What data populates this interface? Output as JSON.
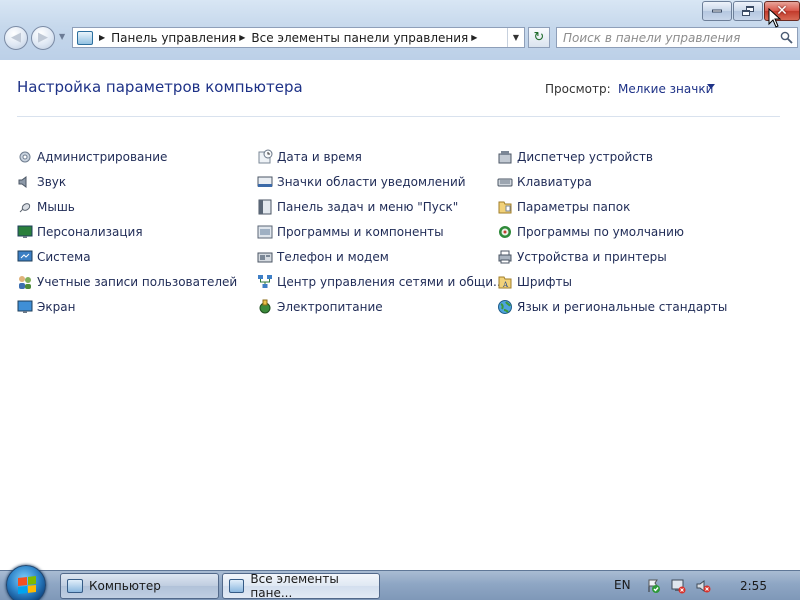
{
  "window": {
    "address": {
      "crumbs": [
        "Панель управления",
        "Все элементы панели управления"
      ]
    },
    "search": {
      "placeholder": "Поиск в панели управления"
    }
  },
  "content": {
    "title": "Настройка параметров компьютера",
    "view_label": "Просмотр:",
    "view_value": "Мелкие значки",
    "columns": [
      [
        {
          "label": "Администрирование",
          "icon": "admin-tools-icon"
        },
        {
          "label": "Звук",
          "icon": "speaker-icon"
        },
        {
          "label": "Мышь",
          "icon": "mouse-icon"
        },
        {
          "label": "Персонализация",
          "icon": "personalization-icon"
        },
        {
          "label": "Система",
          "icon": "system-icon"
        },
        {
          "label": "Учетные записи пользователей",
          "icon": "users-icon"
        },
        {
          "label": "Экран",
          "icon": "display-icon"
        }
      ],
      [
        {
          "label": "Дата и время",
          "icon": "clock-icon"
        },
        {
          "label": "Значки области уведомлений",
          "icon": "notification-icon"
        },
        {
          "label": "Панель задач и меню \"Пуск\"",
          "icon": "taskbar-icon"
        },
        {
          "label": "Программы и компоненты",
          "icon": "programs-icon"
        },
        {
          "label": "Телефон и модем",
          "icon": "phone-modem-icon"
        },
        {
          "label": "Центр управления сетями и общи...",
          "icon": "network-icon"
        },
        {
          "label": "Электропитание",
          "icon": "power-icon"
        }
      ],
      [
        {
          "label": "Диспетчер устройств",
          "icon": "device-manager-icon"
        },
        {
          "label": "Клавиатура",
          "icon": "keyboard-icon"
        },
        {
          "label": "Параметры папок",
          "icon": "folder-options-icon"
        },
        {
          "label": "Программы по умолчанию",
          "icon": "default-programs-icon"
        },
        {
          "label": "Устройства и принтеры",
          "icon": "printer-icon"
        },
        {
          "label": "Шрифты",
          "icon": "fonts-icon"
        },
        {
          "label": "Язык и региональные стандарты",
          "icon": "globe-icon"
        }
      ]
    ]
  },
  "taskbar": {
    "buttons": [
      {
        "label": "Компьютер",
        "active": false
      },
      {
        "label": "Все элементы пане...",
        "active": true
      }
    ],
    "language": "EN",
    "clock": "2:55"
  }
}
